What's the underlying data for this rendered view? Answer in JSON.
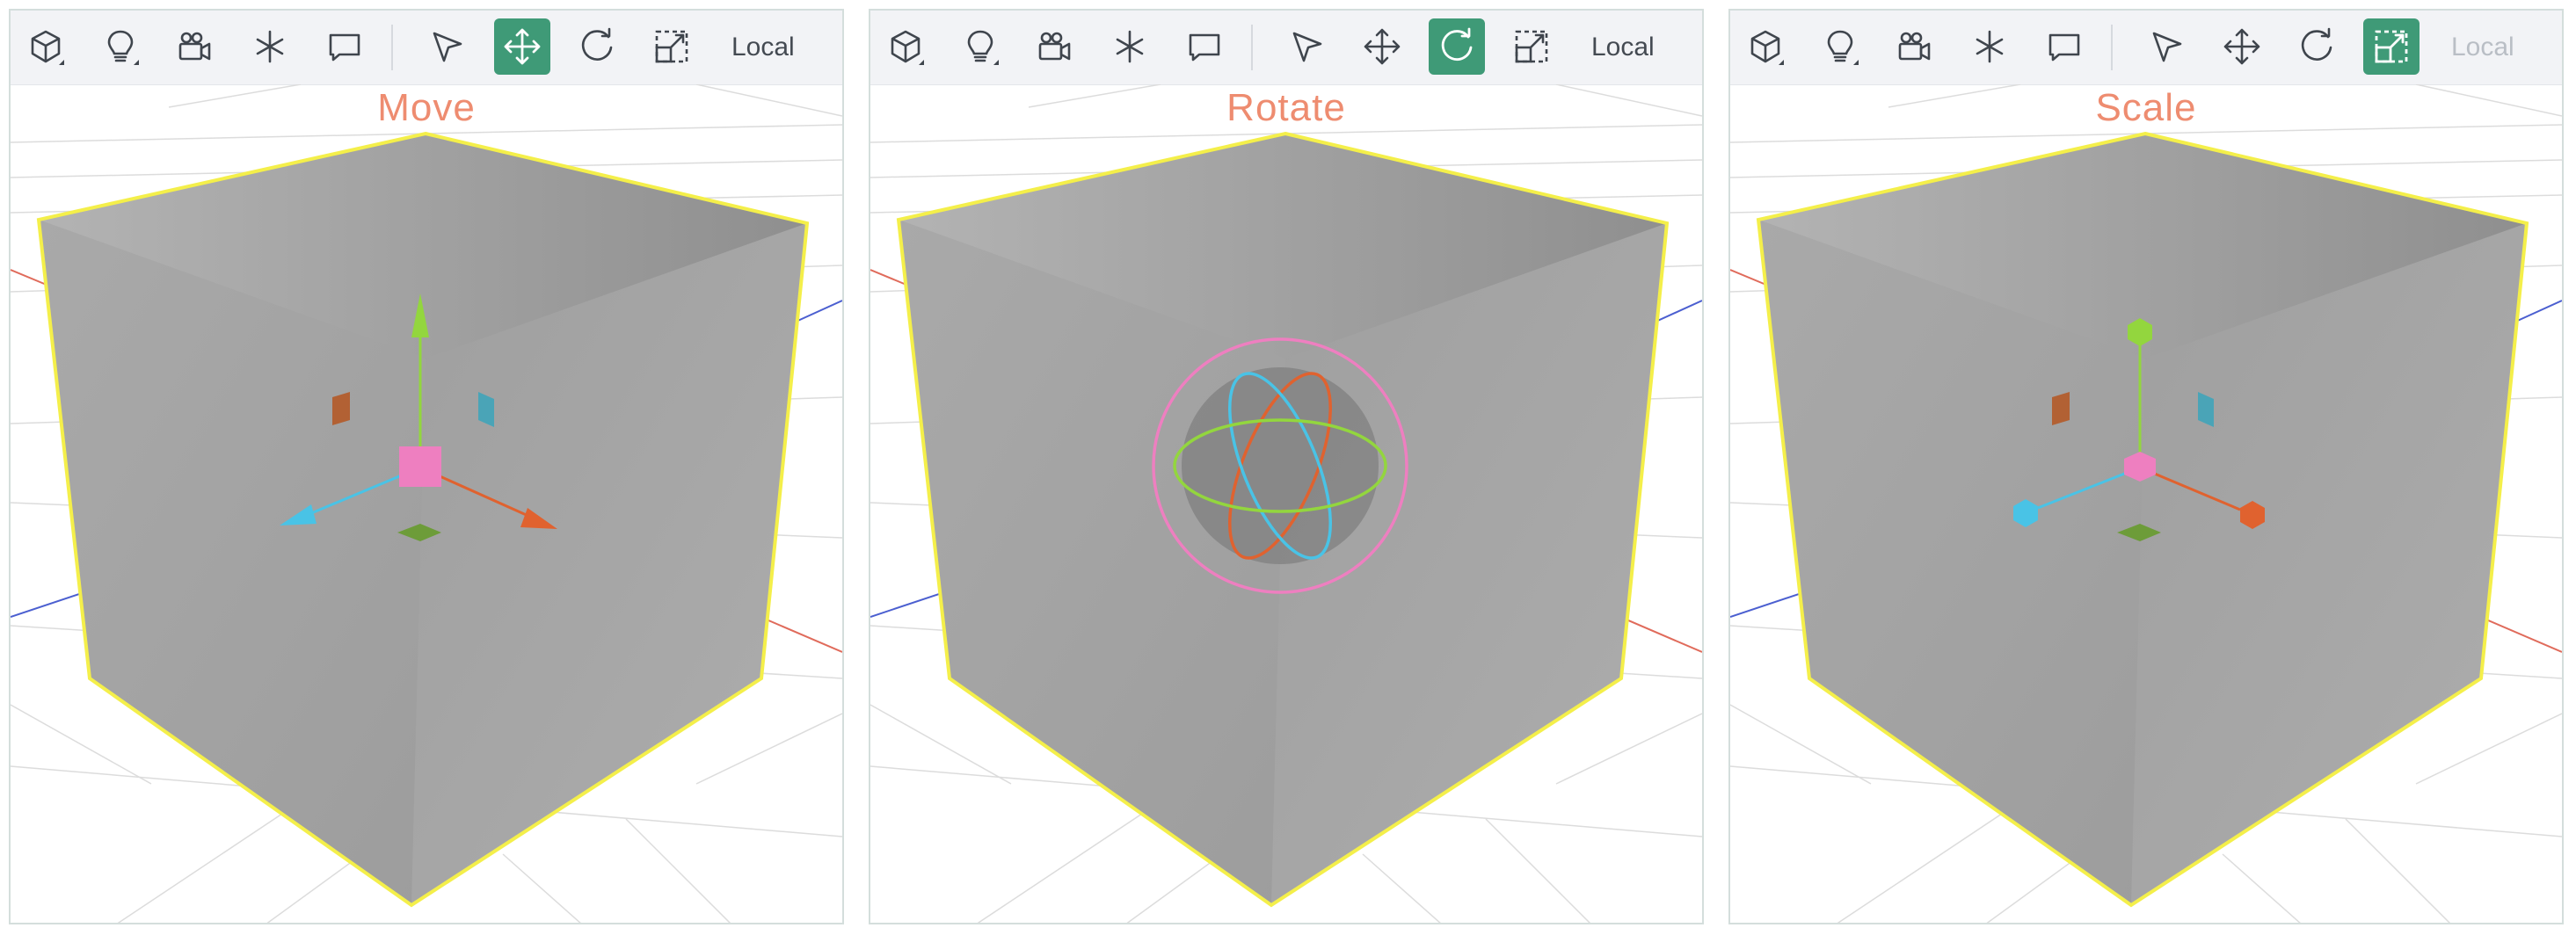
{
  "panels": [
    {
      "mode_title": "Move",
      "space_label": "Local",
      "space_label_enabled": true,
      "active_tool": "move"
    },
    {
      "mode_title": "Rotate",
      "space_label": "Local",
      "space_label_enabled": true,
      "active_tool": "rotate"
    },
    {
      "mode_title": "Scale",
      "space_label": "Local",
      "space_label_enabled": false,
      "active_tool": "scale"
    }
  ],
  "toolbar_icons": [
    "cube-icon",
    "lightbulb-icon",
    "camera-icon",
    "sparkle-icon",
    "comment-icon",
    "cursor-icon",
    "move-icon",
    "rotate-icon",
    "scale-icon"
  ],
  "colors": {
    "accent": "#3f9a77",
    "title": "#ee8c70",
    "selection_outline": "#f4ef4a",
    "axis_x": "#e0622f",
    "axis_y": "#93d63e",
    "axis_z": "#49c3e6",
    "center": "#ee7fc0"
  }
}
